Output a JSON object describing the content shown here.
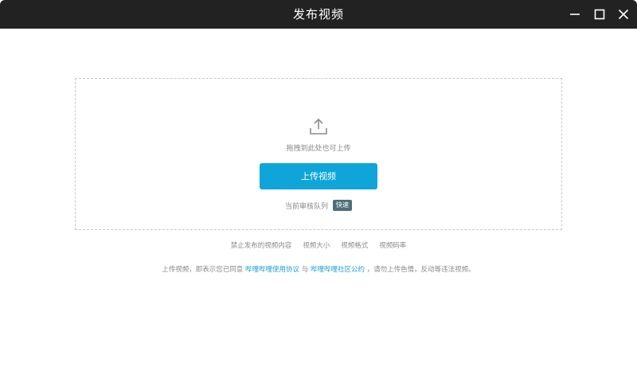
{
  "window": {
    "title": "发布视频"
  },
  "upload": {
    "drag_hint": "拖拽到此处也可上传",
    "button_label": "上传视频",
    "queue_label": "当前审核队列",
    "queue_status": "快速"
  },
  "rules": {
    "items": [
      "禁止发布的视频内容",
      "视频大小",
      "视频格式",
      "视频码率"
    ]
  },
  "agreement": {
    "prefix": "上传视频，即表示您已同意",
    "link1": "哔哩哔哩使用协议",
    "conj": "与",
    "link2": "哔哩哔哩社区公约",
    "suffix": "，请勿上传色情，反动等违法视频。"
  },
  "colors": {
    "accent": "#10a5d8",
    "link": "#1fa0d0",
    "badge": "#4e6f78",
    "titlebar": "#222222"
  },
  "icons": {
    "upload": "upload-tray-arrow-icon",
    "minimize": "minimize-icon",
    "maximize": "maximize-icon",
    "close": "close-icon"
  }
}
